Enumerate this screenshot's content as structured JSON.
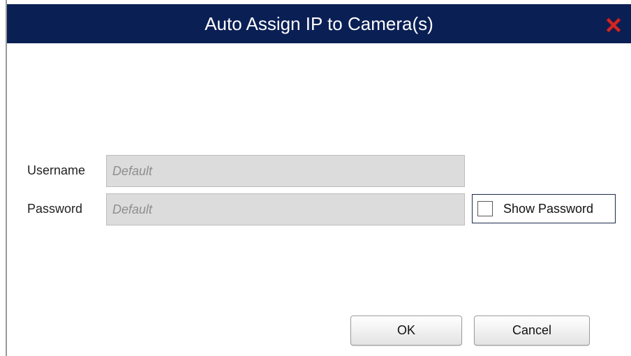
{
  "dialog": {
    "title": "Auto Assign IP to Camera(s)",
    "close_icon": "close-icon",
    "accent_color": "#0a1f54",
    "close_color": "#d02828"
  },
  "form": {
    "username": {
      "label": "Username",
      "value": "",
      "placeholder": "Default"
    },
    "password": {
      "label": "Password",
      "value": "",
      "placeholder": "Default"
    },
    "show_password": {
      "label": "Show Password",
      "checked": false
    }
  },
  "buttons": {
    "ok_label": "OK",
    "cancel_label": "Cancel"
  }
}
